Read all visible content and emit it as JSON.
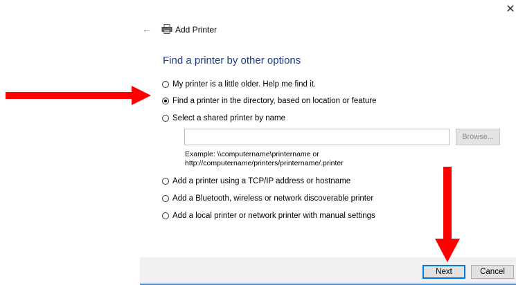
{
  "window": {
    "close_glyph": "✕",
    "back_glyph": "←",
    "title": "Add Printer"
  },
  "heading": "Find a printer by other options",
  "options": [
    {
      "label": "My printer is a little older. Help me find it.",
      "selected": false
    },
    {
      "label": "Find a printer in the directory, based on location or feature",
      "selected": true
    },
    {
      "label": "Select a shared printer by name",
      "selected": false
    },
    {
      "label": "Add a printer using a TCP/IP address or hostname",
      "selected": false
    },
    {
      "label": "Add a Bluetooth, wireless or network discoverable printer",
      "selected": false
    },
    {
      "label": "Add a local printer or network printer with manual settings",
      "selected": false
    }
  ],
  "shared_printer": {
    "value": "",
    "placeholder": "",
    "browse_label": "Browse...",
    "example_line1": "Example: \\\\computername\\printername or",
    "example_line2": "http://computername/printers/printername/.printer"
  },
  "footer": {
    "next_label": "Next",
    "cancel_label": "Cancel"
  },
  "colors": {
    "heading": "#1e3a8a",
    "annotation_arrow": "#ff0000",
    "accent": "#0078d7"
  },
  "icons": {
    "close": "close-icon",
    "back": "back-arrow-icon",
    "printer": "printer-icon"
  }
}
